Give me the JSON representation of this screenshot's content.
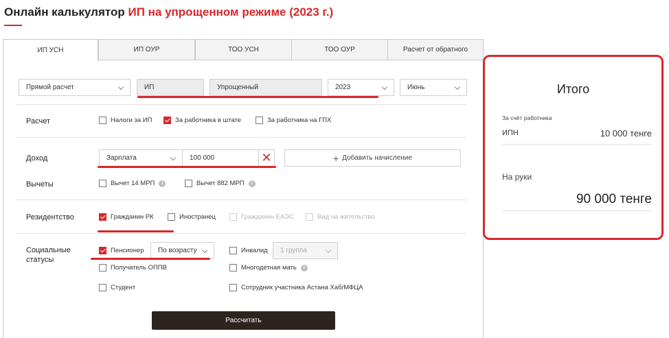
{
  "header": {
    "title_prefix": "Онлайн калькулятор",
    "title_highlight": "ИП на упрощенном режиме (2023 г.)"
  },
  "tabs": [
    {
      "label": "ИП УСН",
      "active": true
    },
    {
      "label": "ИП ОУР",
      "active": false
    },
    {
      "label": "ТОО УСН",
      "active": false
    },
    {
      "label": "ТОО ОУР",
      "active": false
    },
    {
      "label": "Расчет от обратного",
      "active": false
    }
  ],
  "top_row": {
    "calc_type": "Прямой расчет",
    "entity": "ИП",
    "regime": "Упрощенный",
    "year": "2023",
    "month": "Июнь"
  },
  "calculation": {
    "label": "Расчет",
    "options": [
      {
        "label": "Налоги за ИП",
        "checked": false
      },
      {
        "label": "За работника в штате",
        "checked": true
      },
      {
        "label": "За работника на ГПХ",
        "checked": false
      }
    ]
  },
  "income": {
    "label": "Доход",
    "type": "Зарплата",
    "amount": "100 000",
    "add_button": "Добавить начисление"
  },
  "deductions": {
    "label": "Вычеты",
    "options": [
      {
        "label": "Вычет 14 МРП",
        "checked": false
      },
      {
        "label": "Вычет 882 МРП",
        "checked": false
      }
    ]
  },
  "residency": {
    "label": "Резидентство",
    "options": [
      {
        "label": "Гражданин РК",
        "checked": true,
        "disabled": false
      },
      {
        "label": "Иностранец",
        "checked": false,
        "disabled": false
      },
      {
        "label": "Гражданин ЕАЭС",
        "checked": false,
        "disabled": true
      },
      {
        "label": "Вид на жительство",
        "checked": false,
        "disabled": true
      }
    ]
  },
  "social": {
    "label": "Социальные статусы",
    "pensioner": {
      "label": "Пенсионер",
      "checked": true,
      "select": "По возрасту"
    },
    "invalid": {
      "label": "Инвалид",
      "checked": false,
      "select": "1 группа"
    },
    "oppv": {
      "label": "Получатель ОППВ",
      "checked": false
    },
    "mother": {
      "label": "Многодетная мать",
      "checked": false
    },
    "student": {
      "label": "Студент",
      "checked": false
    },
    "astana": {
      "label": "Сотрудник участника Астана Хаб/МФЦА",
      "checked": false
    }
  },
  "calculate_button": "Рассчитать",
  "result": {
    "title": "Итого",
    "employee_section": "За счёт работника",
    "ipn_label": "ИПН",
    "ipn_value": "10 000 тенге",
    "net_label": "На руки",
    "net_value": "90 000 тенге"
  },
  "colors": {
    "accent": "#d7282b",
    "button_dark": "#2d2420"
  }
}
